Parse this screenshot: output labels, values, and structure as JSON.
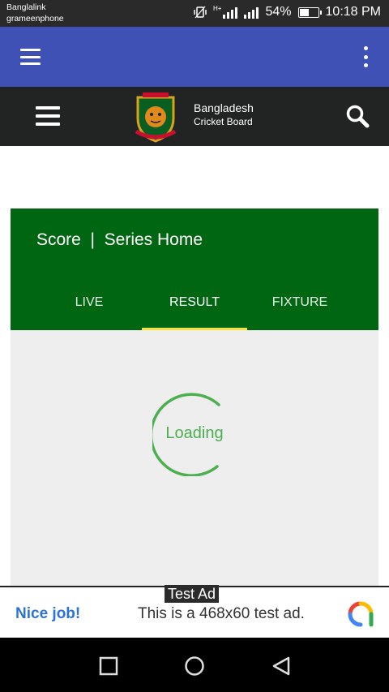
{
  "status_bar": {
    "carrier_1": "Banglalink",
    "carrier_2": "grameenphone",
    "network_type": "H+",
    "battery_percent": "54%",
    "battery_level": 0.54,
    "time": "10:18 PM",
    "icons": [
      "vibrate-icon",
      "signal-icon",
      "signal-icon",
      "battery-icon"
    ]
  },
  "app_bar": {
    "icons": [
      "menu-icon",
      "overflow-menu-icon"
    ]
  },
  "header": {
    "title_line1": "Bangladesh",
    "title_line2": "Cricket Board",
    "icons": [
      "menu-icon",
      "bcb-logo",
      "search-icon"
    ]
  },
  "score_card": {
    "title": "Score  |  Series Home",
    "tabs": [
      {
        "label": "LIVE",
        "active": false
      },
      {
        "label": "RESULT",
        "active": true
      },
      {
        "label": "FIXTURE",
        "active": false
      }
    ],
    "loading_text": "Loading"
  },
  "ad": {
    "tag": "Test Ad",
    "headline": "Nice job!",
    "body": "This is a 468x60 test ad.",
    "icon": "adchoices-icon"
  },
  "nav_bar": {
    "icons": [
      "recents-icon",
      "home-icon",
      "back-icon"
    ]
  },
  "colors": {
    "status_bar": "#2a2a2a",
    "app_bar": "#3f51b5",
    "header": "#222323",
    "score_card": "#006612",
    "tab_indicator": "#f3e33c",
    "spinner": "#4caf50",
    "ad_headline": "#2d73d4"
  }
}
